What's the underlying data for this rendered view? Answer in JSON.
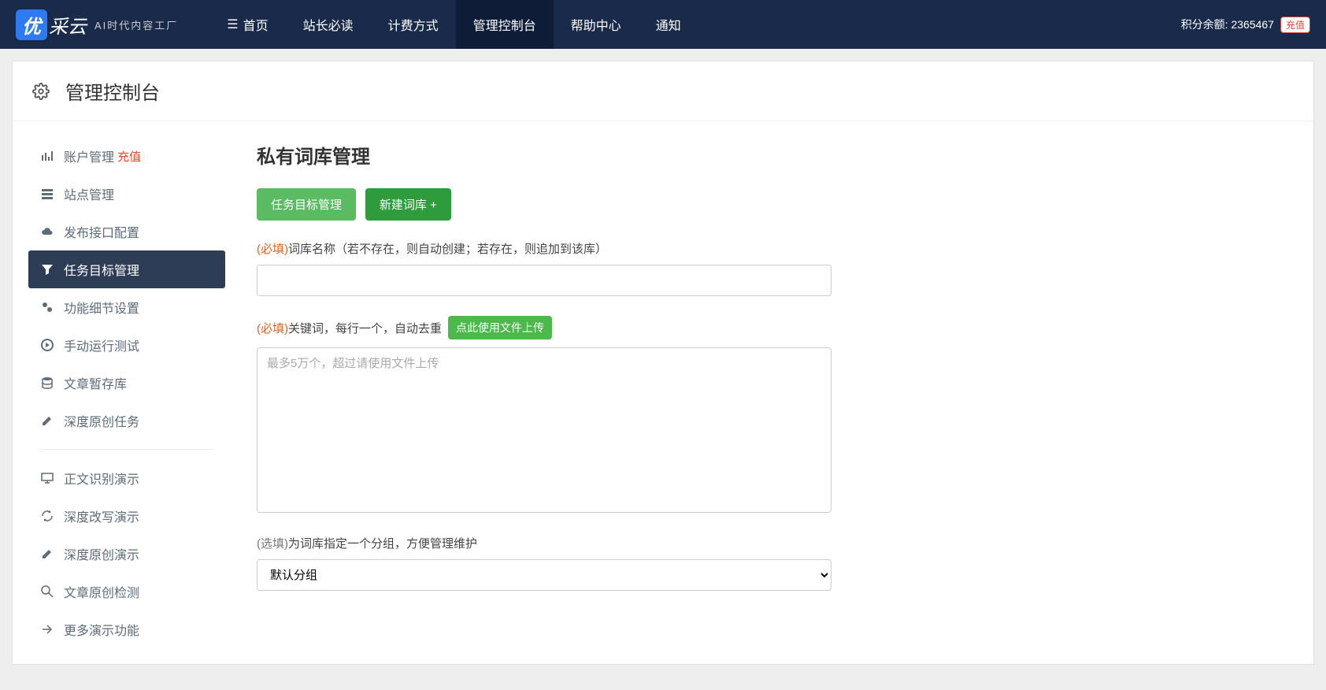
{
  "topnav": {
    "logo_badge": "优",
    "logo_text": "采云",
    "logo_sub": "AI时代内容工厂",
    "links": [
      {
        "label": "首页"
      },
      {
        "label": "站长必读"
      },
      {
        "label": "计费方式"
      },
      {
        "label": "管理控制台",
        "active": true
      },
      {
        "label": "帮助中心"
      },
      {
        "label": "通知"
      }
    ],
    "credits_label": "积分余额: ",
    "credits_value": "2365467",
    "recharge": "充值"
  },
  "panel_title": "管理控制台",
  "sidebar": {
    "groups": [
      [
        {
          "icon": "bars",
          "label": "账户管理",
          "tag": "充值"
        },
        {
          "icon": "grid",
          "label": "站点管理"
        },
        {
          "icon": "cloud",
          "label": "发布接口配置"
        },
        {
          "icon": "filter",
          "label": "任务目标管理",
          "active": true
        },
        {
          "icon": "cogs",
          "label": "功能细节设置"
        },
        {
          "icon": "play",
          "label": "手动运行测试"
        },
        {
          "icon": "db",
          "label": "文章暂存库"
        },
        {
          "icon": "edit",
          "label": "深度原创任务"
        }
      ],
      [
        {
          "icon": "monitor",
          "label": "正文识别演示"
        },
        {
          "icon": "refresh",
          "label": "深度改写演示"
        },
        {
          "icon": "edit",
          "label": "深度原创演示"
        },
        {
          "icon": "search",
          "label": "文章原创检测"
        },
        {
          "icon": "share",
          "label": "更多演示功能"
        }
      ]
    ]
  },
  "main": {
    "title": "私有词库管理",
    "btn1": "任务目标管理",
    "btn2": "新建词库 +",
    "required_text": "(必填)",
    "optional_text": "(选填)",
    "label_name": "词库名称（若不存在，则自动创建；若存在，则追加到该库）",
    "label_keywords": "关键词，每行一个，自动去重",
    "file_upload_btn": "点此使用文件上传",
    "keywords_placeholder": "最多5万个，超过请使用文件上传",
    "label_group": "为词库指定一个分组，方便管理维护",
    "group_default": "默认分组"
  }
}
